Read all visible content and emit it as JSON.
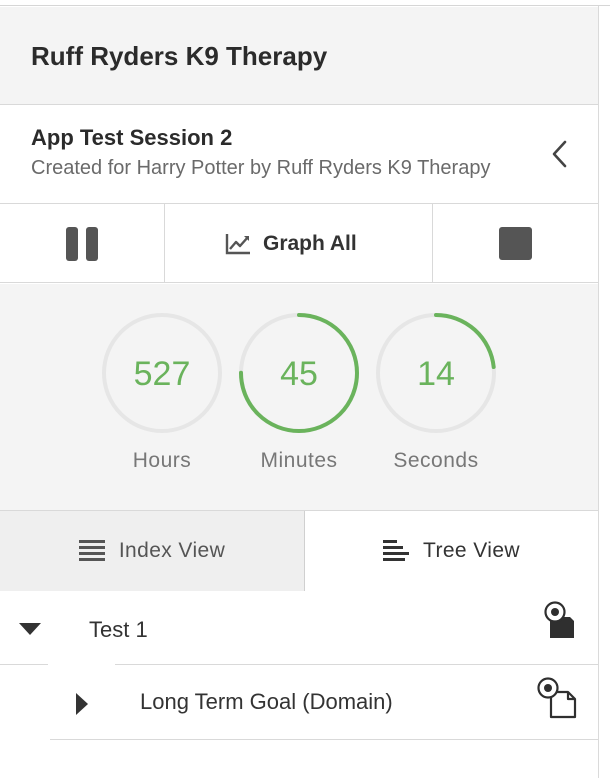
{
  "app": {
    "title": "Ruff Ryders K9 Therapy"
  },
  "session": {
    "title": "App Test Session 2",
    "subtitle": "Created for Harry Potter by Ruff Ryders K9 Therapy"
  },
  "controls": {
    "pause_icon": "pause-icon",
    "graph_label": "Graph All",
    "graph_icon": "line-chart-icon",
    "stop_icon": "stop-icon"
  },
  "timers": [
    {
      "value": "527",
      "label": "Hours",
      "progress": 0.0
    },
    {
      "value": "45",
      "label": "Minutes",
      "progress": 0.75
    },
    {
      "value": "14",
      "label": "Seconds",
      "progress": 0.233
    }
  ],
  "view_tabs": [
    {
      "label": "Index View",
      "icon": "list-icon",
      "active": true
    },
    {
      "label": "Tree View",
      "icon": "tree-list-icon",
      "active": false
    }
  ],
  "tree": [
    {
      "label": "Test 1",
      "expanded": true,
      "icon": "target-document-icon"
    },
    {
      "label": "Long Term Goal (Domain)",
      "expanded": false,
      "icon": "target-document-outline-icon"
    }
  ],
  "colors": {
    "accent_green": "#6ab35c",
    "ring_track": "#e6e6e6",
    "icon_dark": "#555555"
  }
}
